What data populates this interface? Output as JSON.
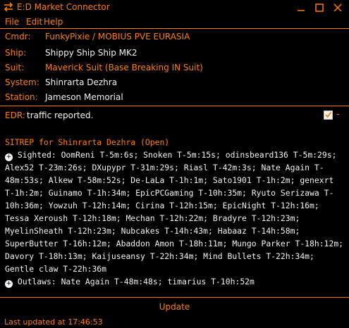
{
  "window": {
    "title": "E:D Market Connector",
    "icon": "edmc-arrows-icon",
    "controls": [
      "minimize-icon",
      "maximize-icon",
      "close-icon"
    ]
  },
  "menu": {
    "file": "File",
    "edit": "Edit",
    "help": "Help"
  },
  "info": {
    "cmdr_label": "Cmdr:",
    "cmdr_value": "FunkyPixie / MOBIUS PVE EURASIA",
    "ship_label": "Ship:",
    "ship_value": "Shippy Ship Ship MK2",
    "suit_label": "Suit:",
    "suit_value": "Maverick Suit (Base Breaking IN Suit)",
    "system_label": "System:",
    "system_value": "Shinrarta Dezhra",
    "station_label": "Station:",
    "station_value": "Jameson Memorial"
  },
  "edr": {
    "label": "EDR:",
    "status": "traffic reported.",
    "toggle_symbol": "-"
  },
  "sitrep": {
    "title": "SITREP for Shinrarta Dezhra (Open)",
    "sighted": "Sighted: OomReni T-5m:6s; Snoken T-5m:15s; odinsbeard136 T-5m:29s; Alex52 T-23m:26s; DXupypr T-31m:29s; Riasl T-42m:3s; Nate Again T-48m:53s; Alkew T-58m:52s; De-LaLa T-1h:1m; Sato1901 T-1h:2m; genexrt T-1h:2m; Guinamo T-1h:34m; EpicPCGaming T-10h:35m; Ryuto Serizawa T-10h:36m; Yowzuh T-12h:14m; Cirina T-12h:15m; EpicNight T-12h:16m; Tessa Xeroush T-12h:18m; Mechan T-12h:22m; Bradyre T-12h:23m; MyelinSheath T-12h:23m; Nubcakes T-14h:43m; Habaaz T-14h:58m; SuperButter T-16h:12m; Abaddon Amon T-18h:11m; Mungo Parker T-18h:12m; Davory T-18h:13m; Kaijuseansy T-22h:34m; Mind Bullets T-22h:34m; Gentle claw T-22h:36m",
    "outlaws": "Outlaws: Nate Again T-48m:48s; timarius T-10h:52m"
  },
  "footer": {
    "update_label": "Update",
    "status": "Last updated at 17:46:53"
  },
  "colors": {
    "background": "#000000",
    "accent": "#ff8000",
    "text_white": "#f2f2f2"
  }
}
